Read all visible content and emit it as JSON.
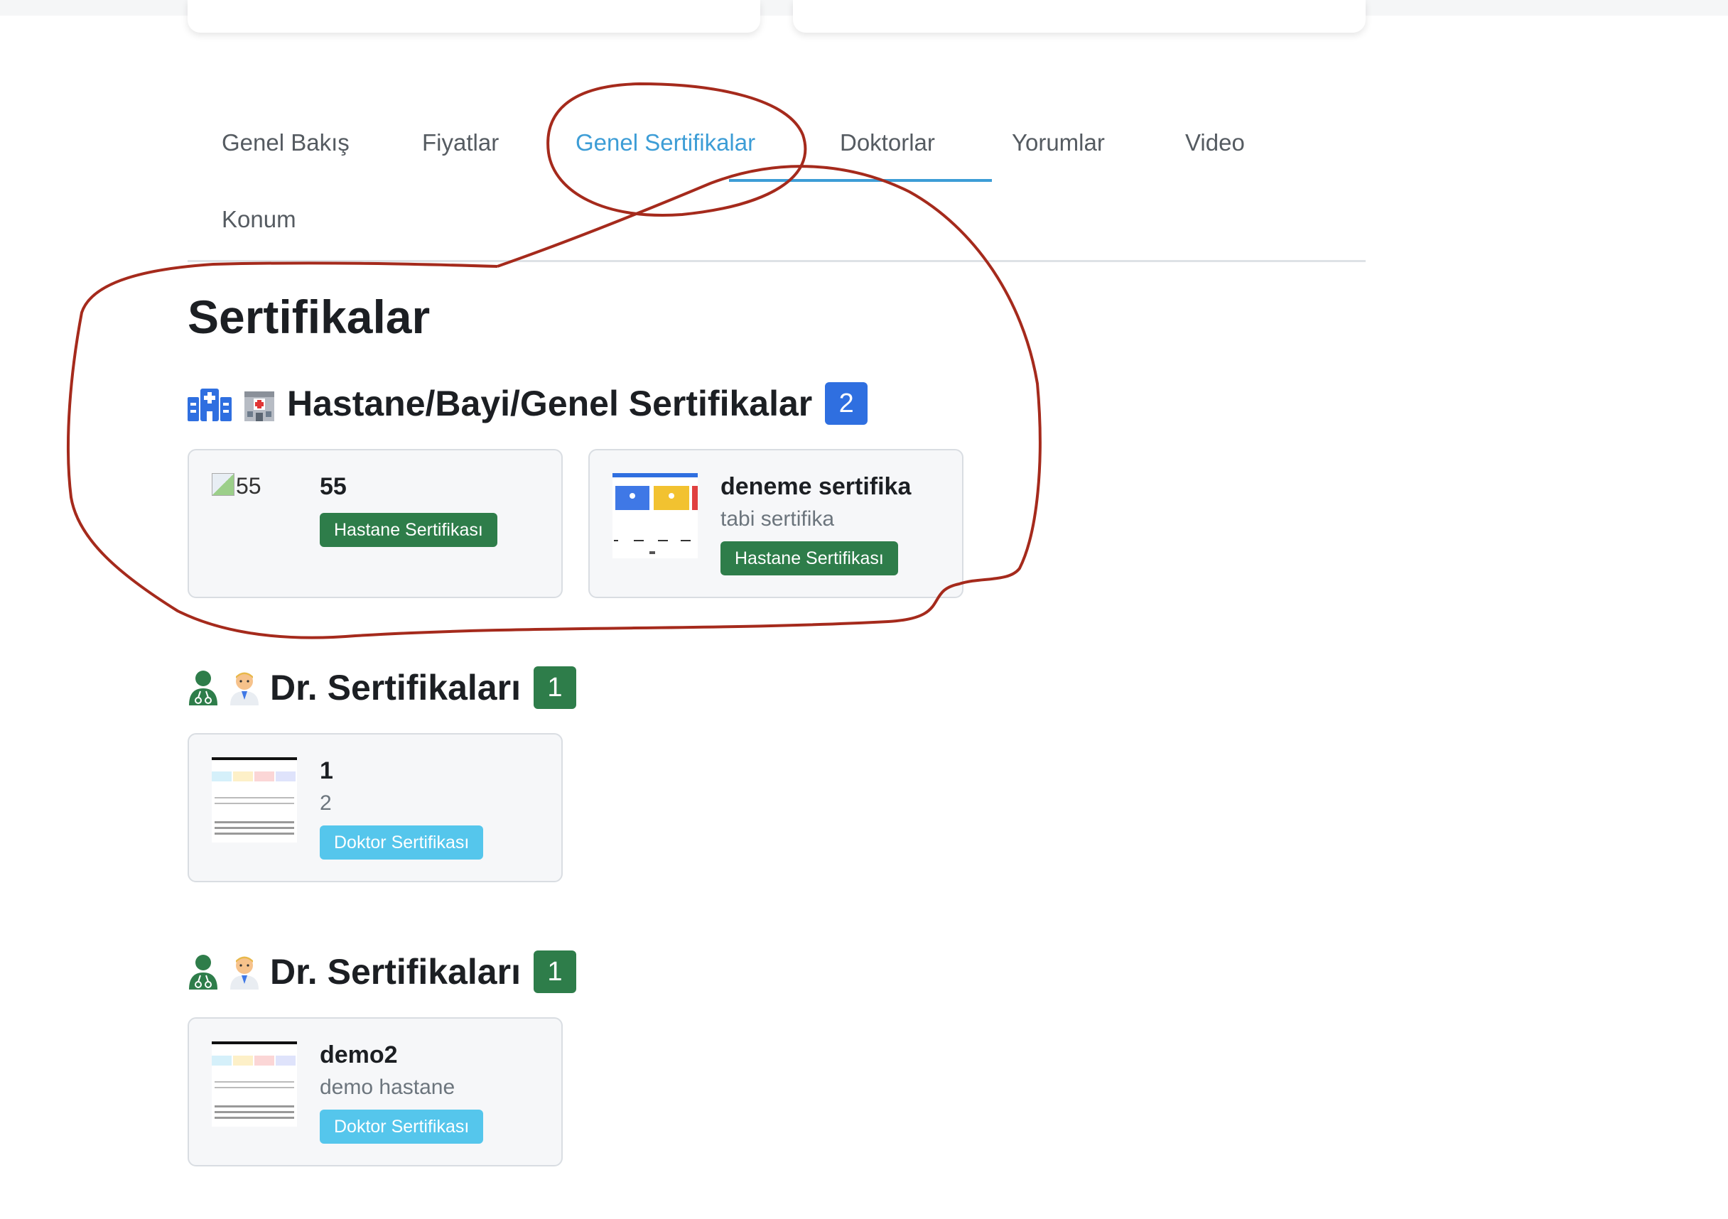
{
  "tabs": [
    {
      "label": "Genel Bakış",
      "active": false
    },
    {
      "label": "Fiyatlar",
      "active": false
    },
    {
      "label": "Genel Sertifikalar",
      "active": true
    },
    {
      "label": "Doktorlar",
      "active": false
    },
    {
      "label": "Yorumlar",
      "active": false
    },
    {
      "label": "Video",
      "active": false
    },
    {
      "label": "Konum",
      "active": false
    }
  ],
  "page_title": "Sertifikalar",
  "sections": [
    {
      "icon": "hospital-icon",
      "emoji": "🏥",
      "title": "Hastane/Bayi/Genel Sertifikalar",
      "count": "2",
      "count_color": "#2f6fe0",
      "items": [
        {
          "name": "55",
          "description": "",
          "badge": "Hastane Sertifikası",
          "image_alt": "55"
        },
        {
          "name": "deneme sertifika",
          "description": "tabi sertifika",
          "badge": "Hastane Sertifikası"
        }
      ]
    },
    {
      "icon": "user-doctor-icon",
      "emoji": "👨‍⚕️",
      "title": "Dr. Sertifikaları",
      "count": "1",
      "count_color": "#2e7d4a",
      "items": [
        {
          "name": "1",
          "description": "2",
          "badge": "Doktor Sertifikası"
        }
      ]
    },
    {
      "icon": "user-doctor-icon",
      "emoji": "👨‍⚕️",
      "title": "Dr. Sertifikaları",
      "count": "1",
      "count_color": "#2e7d4a",
      "items": [
        {
          "name": "demo2",
          "description": "demo hastane",
          "badge": "Doktor Sertifikası"
        }
      ]
    }
  ],
  "colors": {
    "accent": "#3d9dd6",
    "hospital_badge": "#2e7d4a",
    "doctor_badge": "#55c6ec",
    "annotation": "#a52a1c"
  }
}
